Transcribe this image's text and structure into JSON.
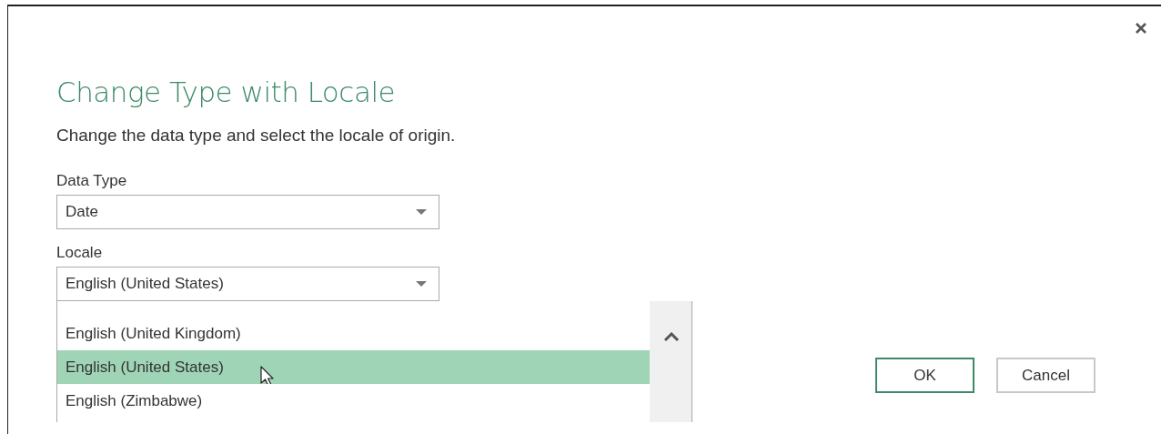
{
  "dialog": {
    "title": "Change Type with Locale",
    "description": "Change the data type and select the locale of origin."
  },
  "data_type": {
    "label": "Data Type",
    "value": "Date"
  },
  "locale": {
    "label": "Locale",
    "value": "English (United States)",
    "expanded": true
  },
  "locale_options": [
    {
      "label": "English (United Kingdom)",
      "selected": false
    },
    {
      "label": "English (United States)",
      "selected": true
    },
    {
      "label": "English (Zimbabwe)",
      "selected": false
    }
  ],
  "buttons": [
    {
      "label": "OK",
      "kind": "primary"
    },
    {
      "label": "Cancel",
      "kind": "secondary"
    }
  ]
}
